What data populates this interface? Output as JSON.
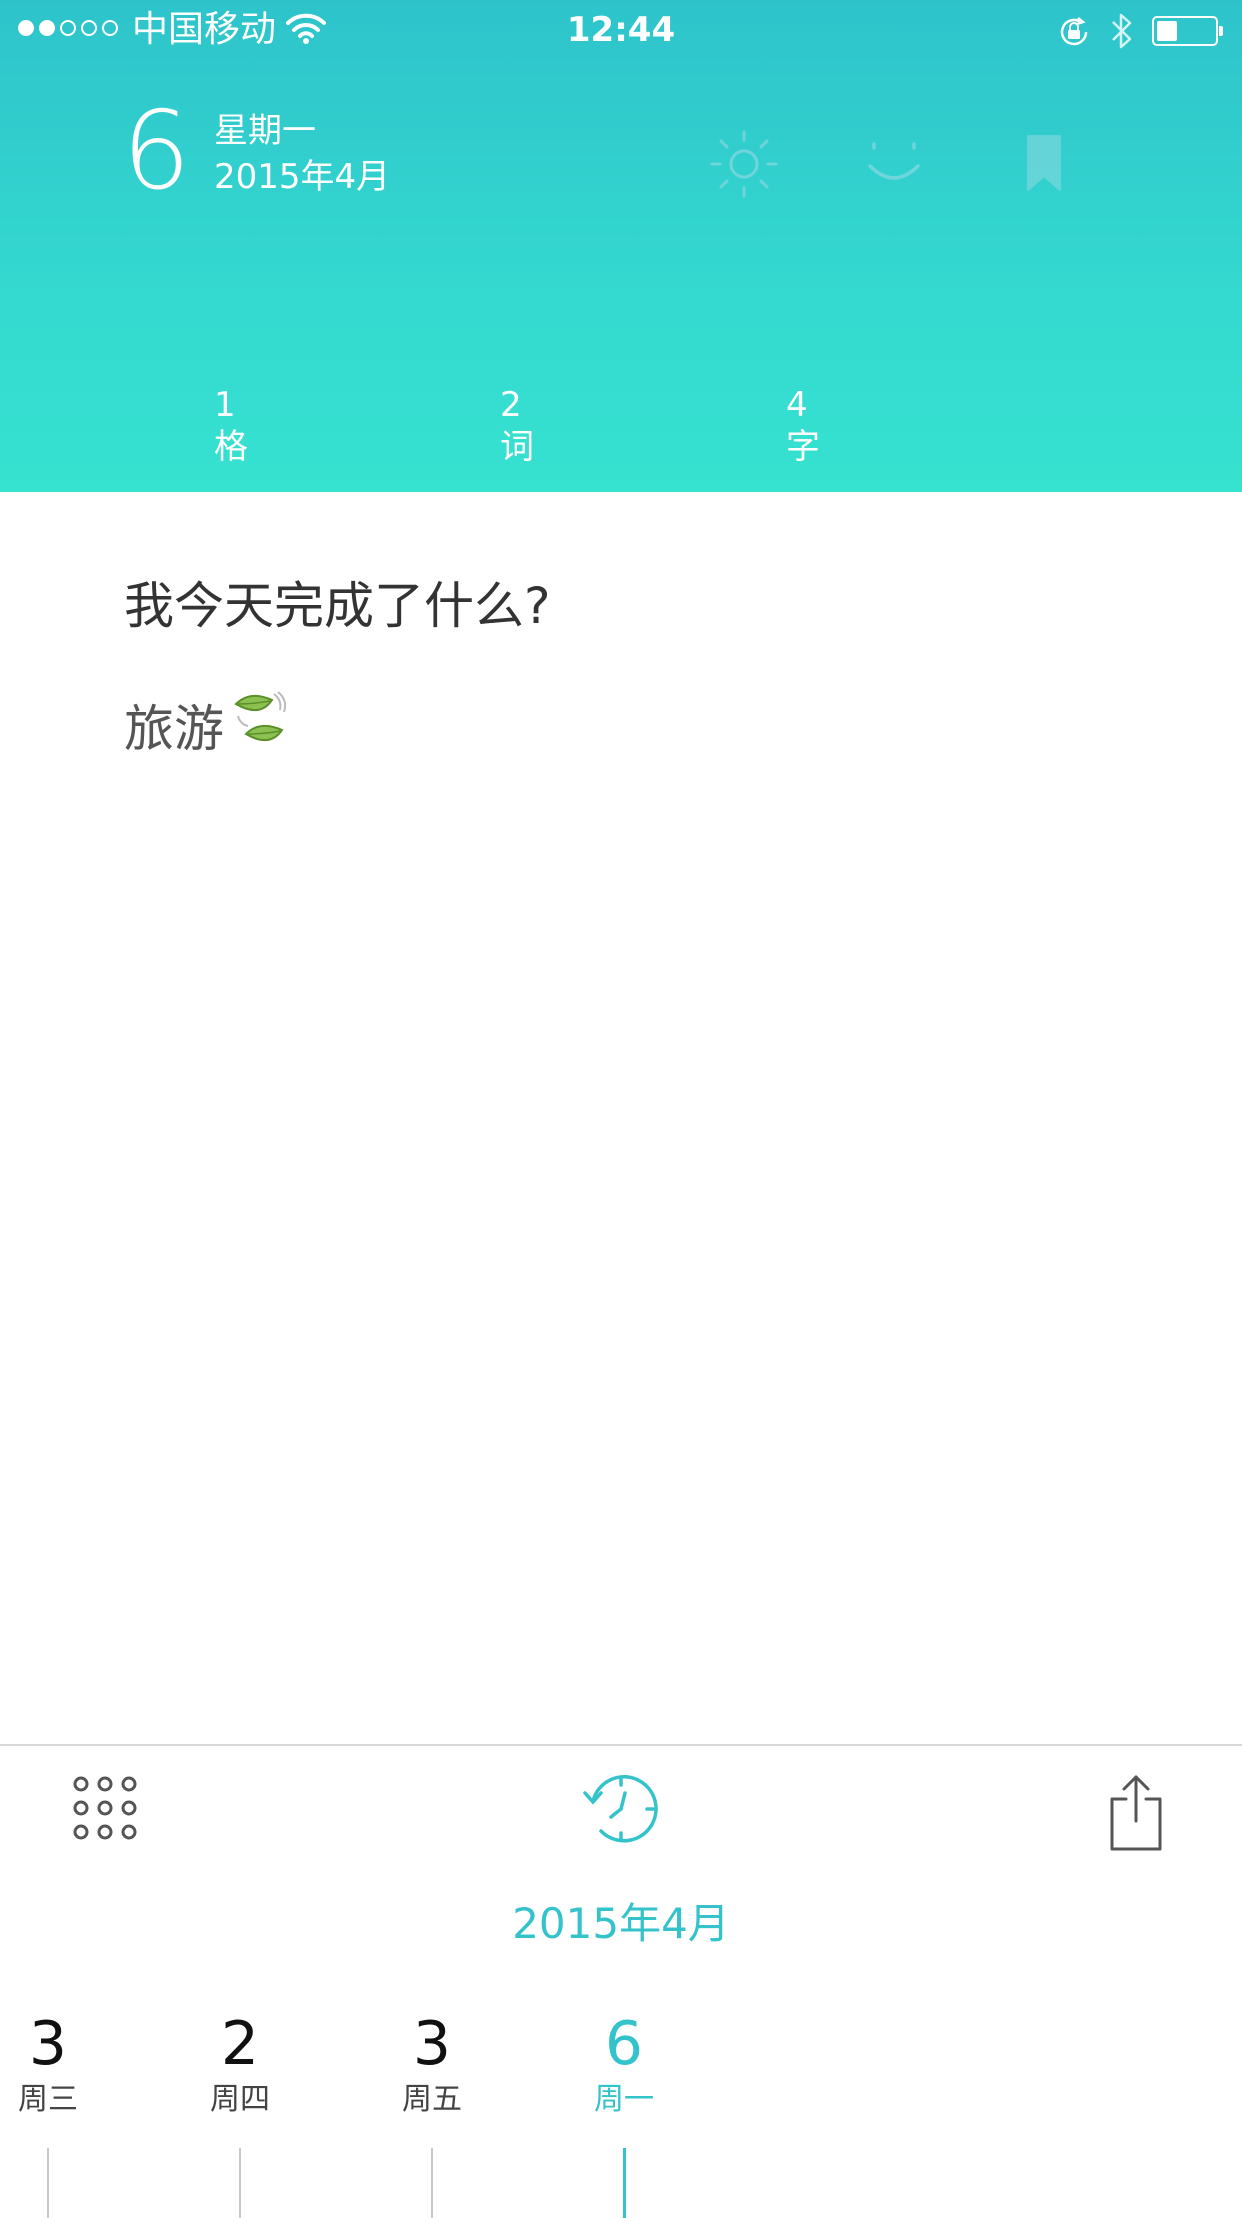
{
  "status_bar": {
    "signal_dots": [
      true,
      true,
      false,
      false,
      false
    ],
    "carrier": "中国移动",
    "time": "12:44",
    "battery_level": 0.35
  },
  "header": {
    "day": "6",
    "weekday": "星期一",
    "month": "2015年4月",
    "icons": [
      "sun-icon",
      "smile-icon",
      "bookmark-icon"
    ],
    "stats": [
      {
        "num": "1",
        "label": "格"
      },
      {
        "num": "2",
        "label": "词"
      },
      {
        "num": "4",
        "label": "字"
      }
    ]
  },
  "entry": {
    "question": "我今天完成了什么?",
    "answer": "旅游"
  },
  "toolbar": {
    "icons": [
      "grid-icon",
      "history-clock-icon",
      "share-icon"
    ]
  },
  "calendar": {
    "month_label": "2015年4月",
    "days": [
      {
        "num": "3",
        "name": "周三",
        "active": false
      },
      {
        "num": "2",
        "name": "周四",
        "active": false
      },
      {
        "num": "3",
        "name": "周五",
        "active": false
      },
      {
        "num": "6",
        "name": "周一",
        "active": true
      }
    ]
  },
  "colors": {
    "accent": "#35c3cb",
    "header_top": "#2ec3cb",
    "header_bottom": "#36e2d0"
  }
}
